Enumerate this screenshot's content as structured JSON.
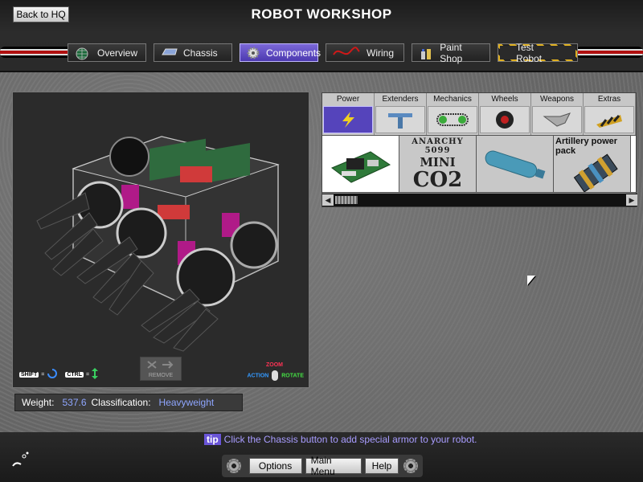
{
  "header": {
    "back_label": "Back to HQ",
    "title": "ROBOT WORKSHOP"
  },
  "tabs": [
    {
      "label": "Overview",
      "icon": "globe-icon"
    },
    {
      "label": "Chassis",
      "icon": "chassis-icon"
    },
    {
      "label": "Components",
      "icon": "gear-icon"
    },
    {
      "label": "Wiring",
      "icon": "wire-icon"
    },
    {
      "label": "Paint Shop",
      "icon": "paint-icon"
    },
    {
      "label": "Test Robot",
      "icon": ""
    }
  ],
  "active_tab": "Components",
  "viewport": {
    "shift_key": "SHIFT",
    "ctrl_key": "CTRL",
    "remove_label": "REMOVE",
    "zoom_label": "ZOOM",
    "action_label": "ACTION",
    "rotate_label": "ROTATE"
  },
  "stats": {
    "weight_label": "Weight:",
    "weight_value": "537.6",
    "class_label": "Classification:",
    "class_value": "Heavyweight"
  },
  "parts": {
    "categories": [
      "Power",
      "Extenders",
      "Mechanics",
      "Wheels",
      "Weapons",
      "Extras"
    ],
    "active_category": "Power",
    "items": [
      {
        "label": "",
        "icon": "circuit-board-icon"
      },
      {
        "label": "",
        "icon": "co2-canister-icon"
      },
      {
        "label": "",
        "icon": "tank-icon"
      },
      {
        "label": "Artillery power pack",
        "icon": "power-pack-icon"
      }
    ],
    "item2_text": {
      "line1": "ANARCHY 5099",
      "line2": "MINI",
      "line3": "CO2"
    }
  },
  "footer": {
    "tip_tag": "tip",
    "tip_text": "Click the Chassis button to add special armor to your robot.",
    "options_label": "Options",
    "main_menu_label": "Main Menu",
    "help_label": "Help"
  }
}
